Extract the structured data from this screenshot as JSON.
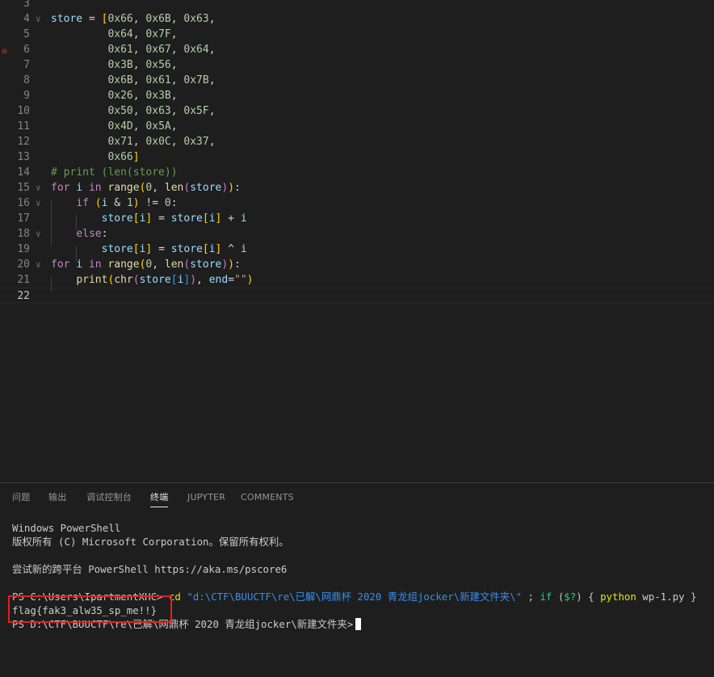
{
  "editor": {
    "lines": [
      {
        "num": "3",
        "tokens": []
      },
      {
        "num": "4",
        "tokens": [
          [
            "t-id",
            "store"
          ],
          [
            "t-op",
            " = "
          ],
          [
            "t-br1",
            "["
          ],
          [
            "t-num",
            "0x66"
          ],
          [
            "t-op",
            ", "
          ],
          [
            "t-num",
            "0x6B"
          ],
          [
            "t-op",
            ", "
          ],
          [
            "t-num",
            "0x63"
          ],
          [
            "t-op",
            ","
          ]
        ]
      },
      {
        "num": "5",
        "tokens": [
          [
            "t-op",
            "         "
          ],
          [
            "t-num",
            "0x64"
          ],
          [
            "t-op",
            ", "
          ],
          [
            "t-num",
            "0x7F"
          ],
          [
            "t-op",
            ","
          ]
        ]
      },
      {
        "num": "6",
        "tokens": [
          [
            "t-op",
            "         "
          ],
          [
            "t-num",
            "0x61"
          ],
          [
            "t-op",
            ", "
          ],
          [
            "t-num",
            "0x67"
          ],
          [
            "t-op",
            ", "
          ],
          [
            "t-num",
            "0x64"
          ],
          [
            "t-op",
            ","
          ]
        ]
      },
      {
        "num": "7",
        "tokens": [
          [
            "t-op",
            "         "
          ],
          [
            "t-num",
            "0x3B"
          ],
          [
            "t-op",
            ", "
          ],
          [
            "t-num",
            "0x56"
          ],
          [
            "t-op",
            ","
          ]
        ]
      },
      {
        "num": "8",
        "tokens": [
          [
            "t-op",
            "         "
          ],
          [
            "t-num",
            "0x6B"
          ],
          [
            "t-op",
            ", "
          ],
          [
            "t-num",
            "0x61"
          ],
          [
            "t-op",
            ", "
          ],
          [
            "t-num",
            "0x7B"
          ],
          [
            "t-op",
            ","
          ]
        ]
      },
      {
        "num": "9",
        "tokens": [
          [
            "t-op",
            "         "
          ],
          [
            "t-num",
            "0x26"
          ],
          [
            "t-op",
            ", "
          ],
          [
            "t-num",
            "0x3B"
          ],
          [
            "t-op",
            ","
          ]
        ]
      },
      {
        "num": "10",
        "tokens": [
          [
            "t-op",
            "         "
          ],
          [
            "t-num",
            "0x50"
          ],
          [
            "t-op",
            ", "
          ],
          [
            "t-num",
            "0x63"
          ],
          [
            "t-op",
            ", "
          ],
          [
            "t-num",
            "0x5F"
          ],
          [
            "t-op",
            ","
          ]
        ]
      },
      {
        "num": "11",
        "tokens": [
          [
            "t-op",
            "         "
          ],
          [
            "t-num",
            "0x4D"
          ],
          [
            "t-op",
            ", "
          ],
          [
            "t-num",
            "0x5A"
          ],
          [
            "t-op",
            ","
          ]
        ]
      },
      {
        "num": "12",
        "tokens": [
          [
            "t-op",
            "         "
          ],
          [
            "t-num",
            "0x71"
          ],
          [
            "t-op",
            ", "
          ],
          [
            "t-num",
            "0x0C"
          ],
          [
            "t-op",
            ", "
          ],
          [
            "t-num",
            "0x37"
          ],
          [
            "t-op",
            ","
          ]
        ]
      },
      {
        "num": "13",
        "tokens": [
          [
            "t-op",
            "         "
          ],
          [
            "t-num",
            "0x66"
          ],
          [
            "t-br1",
            "]"
          ]
        ]
      },
      {
        "num": "14",
        "tokens": [
          [
            "t-cm",
            "# print (len(store))"
          ]
        ]
      },
      {
        "num": "15",
        "tokens": [
          [
            "t-kw",
            "for"
          ],
          [
            "t-op",
            " "
          ],
          [
            "t-id",
            "i"
          ],
          [
            "t-op",
            " "
          ],
          [
            "t-kw",
            "in"
          ],
          [
            "t-op",
            " "
          ],
          [
            "t-fn",
            "range"
          ],
          [
            "t-br1",
            "("
          ],
          [
            "t-num",
            "0"
          ],
          [
            "t-op",
            ", "
          ],
          [
            "t-fn",
            "len"
          ],
          [
            "t-br2",
            "("
          ],
          [
            "t-id",
            "store"
          ],
          [
            "t-br2",
            ")"
          ],
          [
            "t-br1",
            ")"
          ],
          [
            "t-op",
            ":"
          ]
        ]
      },
      {
        "num": "16",
        "tokens": [
          [
            "t-op",
            "    "
          ],
          [
            "t-kw",
            "if"
          ],
          [
            "t-op",
            " "
          ],
          [
            "t-br1",
            "("
          ],
          [
            "t-id",
            "i"
          ],
          [
            "t-op",
            " & "
          ],
          [
            "t-num",
            "1"
          ],
          [
            "t-br1",
            ")"
          ],
          [
            "t-op",
            " != "
          ],
          [
            "t-num",
            "0"
          ],
          [
            "t-op",
            ":"
          ]
        ]
      },
      {
        "num": "17",
        "tokens": [
          [
            "t-op",
            "        "
          ],
          [
            "t-id",
            "store"
          ],
          [
            "t-br1",
            "["
          ],
          [
            "t-id",
            "i"
          ],
          [
            "t-br1",
            "]"
          ],
          [
            "t-op",
            " = "
          ],
          [
            "t-id",
            "store"
          ],
          [
            "t-br1",
            "["
          ],
          [
            "t-id",
            "i"
          ],
          [
            "t-br1",
            "]"
          ],
          [
            "t-op",
            " + "
          ],
          [
            "t-id",
            "i"
          ]
        ]
      },
      {
        "num": "18",
        "tokens": [
          [
            "t-op",
            "    "
          ],
          [
            "t-kw",
            "else"
          ],
          [
            "t-op",
            ":"
          ]
        ]
      },
      {
        "num": "19",
        "tokens": [
          [
            "t-op",
            "        "
          ],
          [
            "t-id",
            "store"
          ],
          [
            "t-br1",
            "["
          ],
          [
            "t-id",
            "i"
          ],
          [
            "t-br1",
            "]"
          ],
          [
            "t-op",
            " = "
          ],
          [
            "t-id",
            "store"
          ],
          [
            "t-br1",
            "["
          ],
          [
            "t-id",
            "i"
          ],
          [
            "t-br1",
            "]"
          ],
          [
            "t-op",
            " ^ "
          ],
          [
            "t-id",
            "i"
          ]
        ]
      },
      {
        "num": "20",
        "tokens": [
          [
            "t-kw",
            "for"
          ],
          [
            "t-op",
            " "
          ],
          [
            "t-id",
            "i"
          ],
          [
            "t-op",
            " "
          ],
          [
            "t-kw",
            "in"
          ],
          [
            "t-op",
            " "
          ],
          [
            "t-fn",
            "range"
          ],
          [
            "t-br1",
            "("
          ],
          [
            "t-num",
            "0"
          ],
          [
            "t-op",
            ", "
          ],
          [
            "t-fn",
            "len"
          ],
          [
            "t-br2",
            "("
          ],
          [
            "t-id",
            "store"
          ],
          [
            "t-br2",
            ")"
          ],
          [
            "t-br1",
            ")"
          ],
          [
            "t-op",
            ":"
          ]
        ]
      },
      {
        "num": "21",
        "tokens": [
          [
            "t-op",
            "    "
          ],
          [
            "t-fn",
            "print"
          ],
          [
            "t-br1",
            "("
          ],
          [
            "t-fn",
            "chr"
          ],
          [
            "t-br2",
            "("
          ],
          [
            "t-id",
            "store"
          ],
          [
            "t-br3",
            "["
          ],
          [
            "t-id",
            "i"
          ],
          [
            "t-br3",
            "]"
          ],
          [
            "t-br2",
            ")"
          ],
          [
            "t-op",
            ", "
          ],
          [
            "t-id",
            "end"
          ],
          [
            "t-op",
            "="
          ],
          [
            "t-str",
            "\"\""
          ],
          [
            "t-br1",
            ")"
          ]
        ]
      },
      {
        "num": "22",
        "tokens": []
      }
    ]
  },
  "panel": {
    "tabs": [
      {
        "label": "问题"
      },
      {
        "label": "输出"
      },
      {
        "label": "调试控制台"
      },
      {
        "label": "终端"
      },
      {
        "label": "JUPYTER"
      },
      {
        "label": "COMMENTS"
      }
    ],
    "active_tab": "终端",
    "terminal": {
      "line1": "Windows PowerShell",
      "line2": "版权所有 (C) Microsoft Corporation。保留所有权利。",
      "line3": "尝试新的跨平台 PowerShell https://aka.ms/pscore6",
      "prompt1": "PS C:\\Users\\IpartmentXHC> ",
      "cmd_cd": "cd",
      "cmd_path": " \"d:\\CTF\\BUUCTF\\re\\已解\\网鼎杯 2020 青龙组jocker\\新建文件夹\\\"",
      "cmd_sep": " ; ",
      "cmd_if": "if",
      "cmd_open": " (",
      "cmd_var": "$?",
      "cmd_close": ") { ",
      "cmd_python": "python",
      "cmd_file": " wp-1.py",
      "cmd_end": " }",
      "output": "flag{fak3_alw35_sp_me!!}",
      "prompt2": "PS D:\\CTF\\BUUCTF\\re\\已解\\网鼎杯 2020 青龙组jocker\\新建文件夹>"
    }
  }
}
